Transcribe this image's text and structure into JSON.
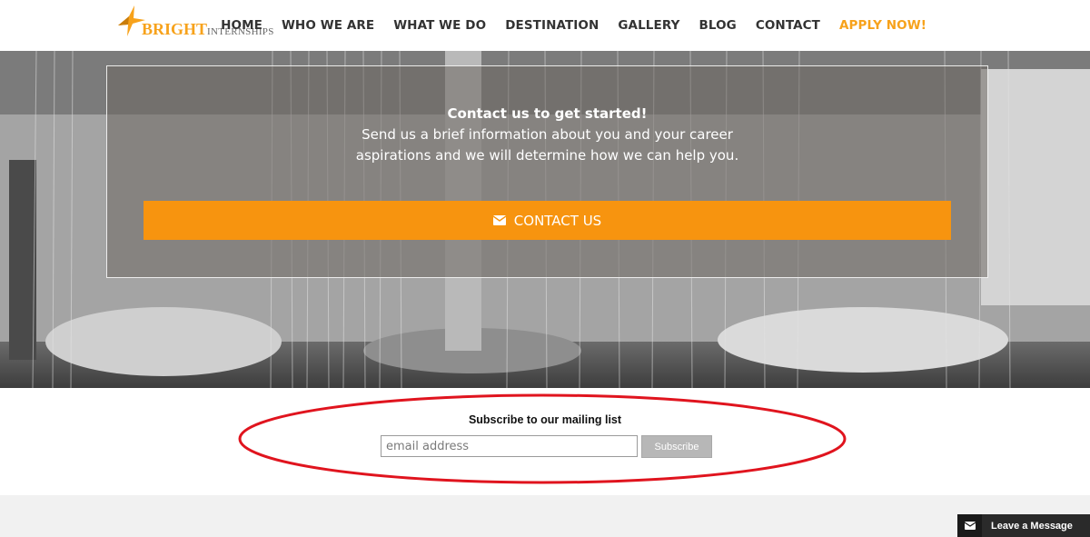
{
  "header": {
    "logo_word": "BRIGHT",
    "logo_sub": "INTERNSHIPS",
    "nav": [
      {
        "label": "HOME"
      },
      {
        "label": "WHO WE ARE"
      },
      {
        "label": "WHAT WE DO"
      },
      {
        "label": "DESTINATION"
      },
      {
        "label": "GALLERY"
      },
      {
        "label": "BLOG"
      },
      {
        "label": "CONTACT"
      },
      {
        "label": "APPLY NOW!"
      }
    ]
  },
  "hero": {
    "headline": "Contact us to get started!",
    "body_line1": "Send us a brief information about you and your career",
    "body_line2": "aspirations and we will determine how we can help you.",
    "contact_button": "CONTACT US"
  },
  "subscribe": {
    "title": "Subscribe to our mailing list",
    "email_placeholder": "email address",
    "button": "Subscribe"
  },
  "chat": {
    "label": "Leave a Message"
  },
  "colors": {
    "accent": "#f7940f",
    "annotation": "#e0141e"
  },
  "icons": [
    "logo-star-icon",
    "envelope-icon",
    "chat-envelope-icon"
  ]
}
